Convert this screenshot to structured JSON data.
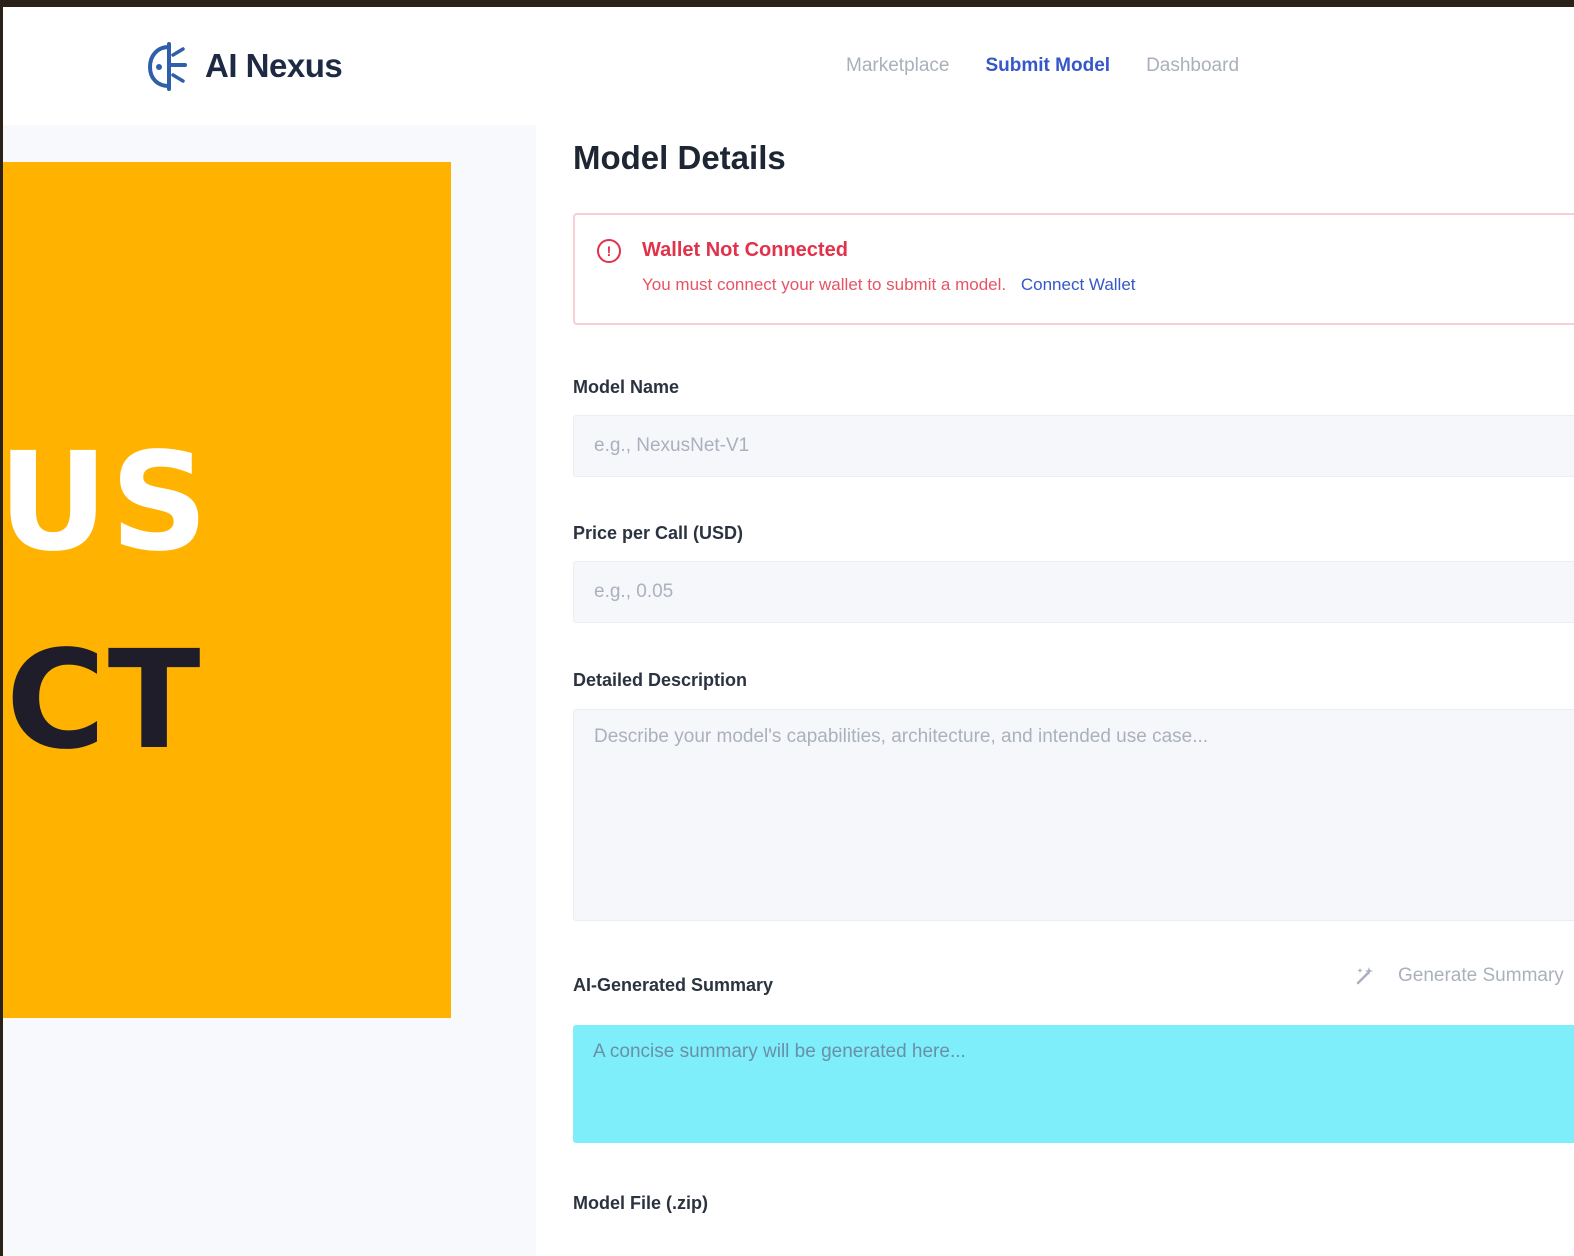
{
  "brand": {
    "name": "AI Nexus"
  },
  "nav": {
    "items": [
      {
        "label": "Marketplace",
        "active": false
      },
      {
        "label": "Submit Model",
        "active": true
      },
      {
        "label": "Dashboard",
        "active": false
      }
    ]
  },
  "banner": {
    "line1": "XUS",
    "line2": "ECT",
    "color": "#ffb300"
  },
  "form": {
    "title": "Model Details",
    "alert": {
      "title": "Wallet Not Connected",
      "message": "You must connect your wallet to submit a model.",
      "link": "Connect Wallet"
    },
    "model_name": {
      "label": "Model Name",
      "placeholder": "e.g., NexusNet-V1",
      "value": ""
    },
    "price": {
      "label": "Price per Call (USD)",
      "placeholder": "e.g., 0.05",
      "value": ""
    },
    "description": {
      "label": "Detailed Description",
      "placeholder": "Describe your model's capabilities, architecture, and intended use case...",
      "value": ""
    },
    "summary": {
      "label": "AI-Generated Summary",
      "button": "Generate Summary",
      "placeholder": "A concise summary will be generated here...",
      "value": ""
    },
    "model_file": {
      "label": "Model File (.zip)"
    }
  },
  "colors": {
    "accent": "#3557c8",
    "error": "#e0324b",
    "summary_bg": "#7eeffa"
  }
}
